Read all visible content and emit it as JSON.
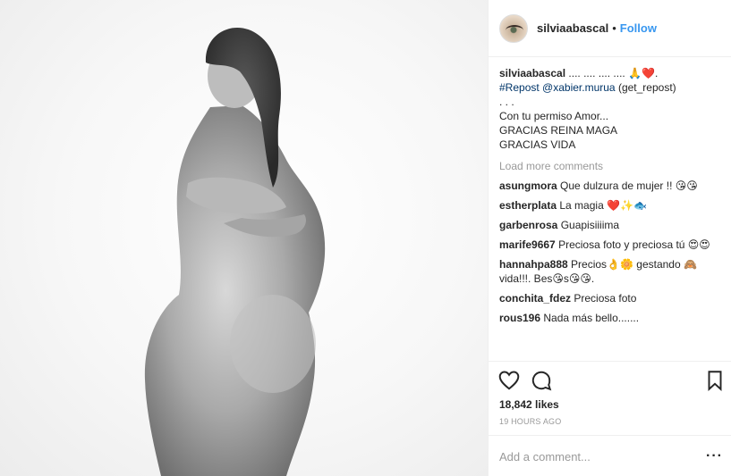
{
  "header": {
    "username": "silviaabascal",
    "separator": "•",
    "follow_label": "Follow"
  },
  "caption": {
    "username": "silviaabascal",
    "text": ".... .... .... .... 🙏❤️.",
    "line2_tag": "#Repost",
    "line2_mention": "@xabier.murua",
    "line2_rest": "(get_repost)",
    "line3": ". . .",
    "line4": "Con tu permiso Amor...",
    "line5": "GRACIAS REINA MAGA",
    "line6": "GRACIAS VIDA"
  },
  "load_more": "Load more comments",
  "comments": [
    {
      "user": "asungmora",
      "text": "Que dulzura de mujer !! 😘😘"
    },
    {
      "user": "estherplata",
      "text": "La magia ❤️✨🐟"
    },
    {
      "user": "garbenrosa",
      "text": "Guapisiiiima"
    },
    {
      "user": "marife9667",
      "text": "Preciosa foto y preciosa tú 😍😍"
    },
    {
      "user": "hannahpa888",
      "text": "Precios👌🌼 gestando 🙈 vida!!!. Bes😘s😘😘."
    },
    {
      "user": "conchita_fdez",
      "text": "Preciosa foto"
    },
    {
      "user": "rous196",
      "text": "Nada más bello......."
    }
  ],
  "likes": "18,842 likes",
  "timestamp": "19 HOURS AGO",
  "add_comment_placeholder": "Add a comment...",
  "more_label": "···",
  "icons": {
    "like": "heart-icon",
    "comment": "comment-icon",
    "save": "bookmark-icon",
    "more": "more-options-icon"
  }
}
